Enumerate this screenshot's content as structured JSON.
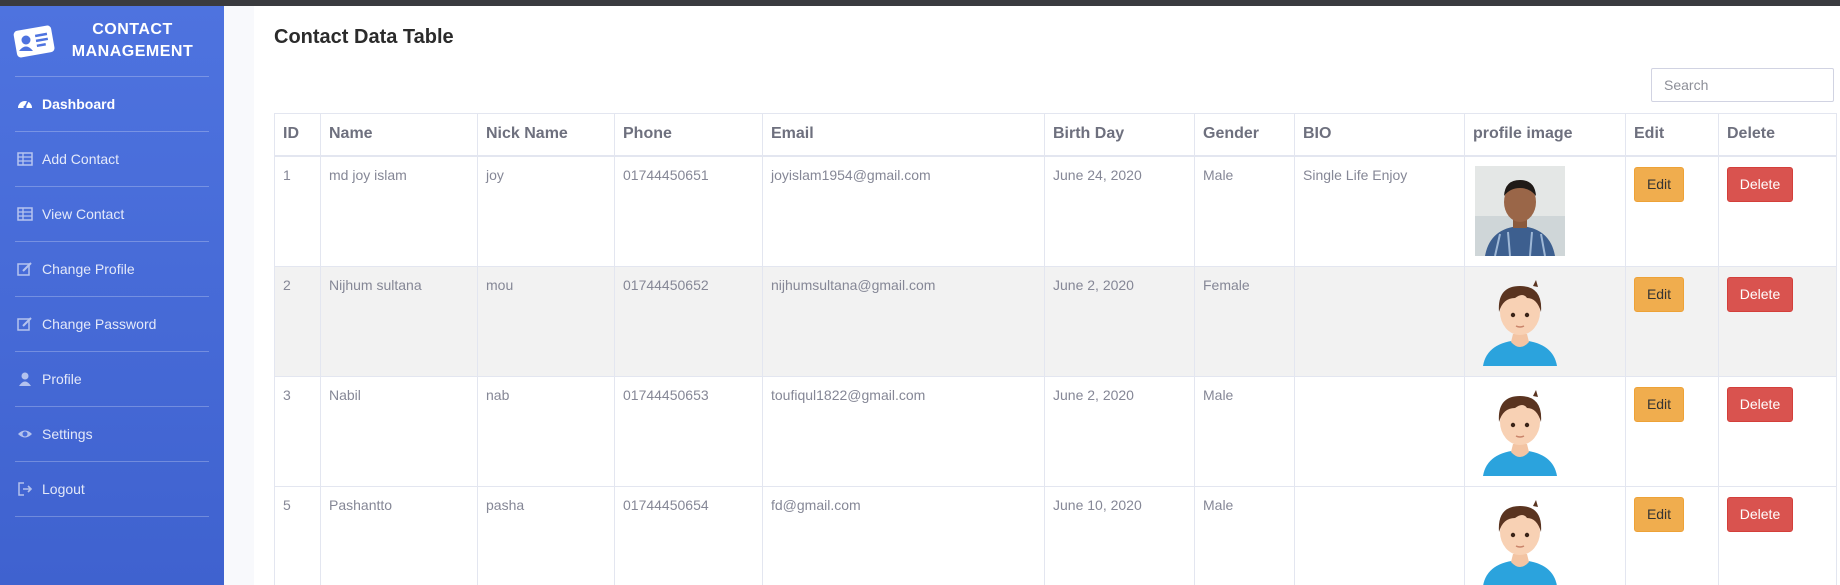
{
  "brand": {
    "line1": "CONTACT",
    "line2": "MANAGEMENT",
    "icon": "contact-card-icon"
  },
  "sidebar": {
    "items": [
      {
        "label": "Dashboard",
        "icon": "tachometer-icon",
        "active": true
      },
      {
        "label": "Add Contact",
        "icon": "table-icon"
      },
      {
        "label": "View Contact",
        "icon": "table-icon"
      },
      {
        "label": "Change Profile",
        "icon": "edit-icon"
      },
      {
        "label": "Change Password",
        "icon": "edit-icon"
      },
      {
        "label": "Profile",
        "icon": "user-icon"
      },
      {
        "label": "Settings",
        "icon": "eye-icon"
      },
      {
        "label": "Logout",
        "icon": "sign-out-icon"
      }
    ]
  },
  "main": {
    "title": "Contact Data Table",
    "search_placeholder": "Search",
    "columns": [
      "ID",
      "Name",
      "Nick Name",
      "Phone",
      "Email",
      "Birth Day",
      "Gender",
      "BIO",
      "profile image",
      "Edit",
      "Delete"
    ],
    "rows": [
      {
        "id": "1",
        "name": "md joy islam",
        "nick": "joy",
        "phone": "01744450651",
        "email": "joyislam1954@gmail.com",
        "birthday": "June 24, 2020",
        "gender": "Male",
        "bio": "Single Life Enjoy",
        "image": "photo"
      },
      {
        "id": "2",
        "name": "Nijhum sultana",
        "nick": "mou",
        "phone": "01744450652",
        "email": "nijhumsultana@gmail.com",
        "birthday": "June 2, 2020",
        "gender": "Female",
        "bio": "",
        "image": "avatar"
      },
      {
        "id": "3",
        "name": "Nabil",
        "nick": "nab",
        "phone": "01744450653",
        "email": "toufiqul1822@gmail.com",
        "birthday": "June 2, 2020",
        "gender": "Male",
        "bio": "",
        "image": "avatar"
      },
      {
        "id": "5",
        "name": "Pashantto",
        "nick": "pasha",
        "phone": "01744450654",
        "email": "fd@gmail.com",
        "birthday": "June 10, 2020",
        "gender": "Male",
        "bio": "",
        "image": "avatar"
      }
    ],
    "edit_label": "Edit",
    "delete_label": "Delete"
  },
  "colors": {
    "sidebar": "#4e73df",
    "edit": "#f0ad4e",
    "delete": "#d9534f"
  }
}
